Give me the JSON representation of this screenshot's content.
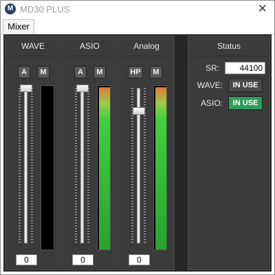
{
  "window": {
    "title": "MD30 PLUS",
    "icon": "M",
    "close_glyph": "✕"
  },
  "tabs": [
    {
      "label": "Mixer"
    }
  ],
  "channels": [
    {
      "name": "WAVE",
      "btn1": "A",
      "btn2": "M",
      "value": "0",
      "meter_l": 0,
      "meter_r": 0
    },
    {
      "name": "ASIO",
      "btn1": "A",
      "btn2": "M",
      "value": "0",
      "meter_l": 1.0,
      "meter_r": 1.0
    },
    {
      "name": "Analog",
      "btn1": "HP",
      "btn2": "M",
      "value": "0",
      "meter_l": 1.0,
      "meter_r": 1.0
    }
  ],
  "status": {
    "title": "Status",
    "sr_label": "SR:",
    "sr_value": "44100",
    "wave_label": "WAVE:",
    "wave_state": "IN USE",
    "asio_label": "ASIO:",
    "asio_state": "IN USE"
  },
  "colors": {
    "meter_green": "#3fd03f",
    "badge_green": "#2e9e5b",
    "panel_bg": "#262626"
  }
}
